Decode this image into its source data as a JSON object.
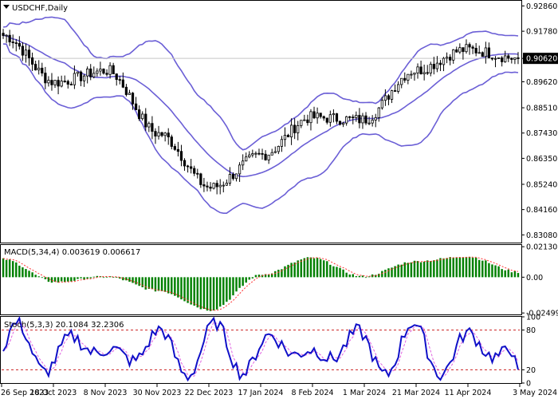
{
  "chart_data": [
    {
      "type": "candlestick",
      "title": "USDCHF,Daily",
      "symbol": "USDCHF",
      "timeframe": "Daily",
      "ylim": [
        0.8275,
        0.9308
      ],
      "y_ticks": [
        "0.92860",
        "0.91780",
        "0.90620",
        "0.89620",
        "0.88510",
        "0.87430",
        "0.86350",
        "0.85240",
        "0.84160",
        "0.83080"
      ],
      "y_tick_values": [
        0.9286,
        0.9178,
        0.9062,
        0.8962,
        0.8851,
        0.8743,
        0.8635,
        0.8524,
        0.8416,
        0.8308
      ],
      "current_price": 0.9062,
      "current_price_label": "0.90620",
      "bollinger_bands": true,
      "key_closes": [
        {
          "date": "26 Sep 2023",
          "close": 0.916
        },
        {
          "date": "18 Oct 2023",
          "close": 0.896
        },
        {
          "date": "8 Nov 2023",
          "close": 0.901
        },
        {
          "date": "30 Nov 2023",
          "close": 0.874
        },
        {
          "date": "22 Dec 2023",
          "close": 0.851
        },
        {
          "date": "17 Jan 2024",
          "close": 0.865
        },
        {
          "date": "8 Feb 2024",
          "close": 0.881
        },
        {
          "date": "1 Mar 2024",
          "close": 0.88
        },
        {
          "date": "21 Mar 2024",
          "close": 0.901
        },
        {
          "date": "11 Apr 2024",
          "close": 0.91
        },
        {
          "date": "3 May 2024",
          "close": 0.9062
        }
      ],
      "x_labels": [
        "26 Sep 2023",
        "18 Oct 2023",
        "8 Nov 2023",
        "30 Nov 2023",
        "22 Dec 2023",
        "17 Jan 2024",
        "8 Feb 2024",
        "1 Mar 2024",
        "21 Mar 2024",
        "11 Apr 2024",
        "3 May 2024"
      ],
      "colors": {
        "band": "#6b5fd6",
        "candle": "#000000",
        "price_tag": "#000000",
        "price_line": "#c8c8c8"
      }
    },
    {
      "type": "bar",
      "title": "MACD(5,34,4) 0.003619 0.006617",
      "name": "MACD",
      "params": "5,34,4",
      "value_main": "0.003619",
      "value_signal": "0.006617",
      "ylim": [
        -0.026,
        0.0225
      ],
      "y_ticks": [
        "0.021303",
        "0.00",
        "-0.024996"
      ],
      "y_tick_values": [
        0.021303,
        0.0,
        -0.024996
      ],
      "histogram_key_values": [
        {
          "date": "26 Sep 2023",
          "value": 0.0125
        },
        {
          "date": "18 Oct 2023",
          "value": -0.0035
        },
        {
          "date": "8 Nov 2023",
          "value": 0.0005
        },
        {
          "date": "30 Nov 2023",
          "value": -0.0095
        },
        {
          "date": "22 Dec 2023",
          "value": -0.023
        },
        {
          "date": "17 Jan 2024",
          "value": 0.002
        },
        {
          "date": "8 Feb 2024",
          "value": 0.0135
        },
        {
          "date": "1 Mar 2024",
          "value": 0.0005
        },
        {
          "date": "21 Mar 2024",
          "value": 0.011
        },
        {
          "date": "11 Apr 2024",
          "value": 0.0145
        },
        {
          "date": "3 May 2024",
          "value": 0.0036
        }
      ],
      "colors": {
        "histogram": "#008000",
        "signal": "#ff3030"
      }
    },
    {
      "type": "line",
      "title": "Stoch(5,3,3) 20.1084 32.2306",
      "name": "Stoch",
      "params": "5,3,3",
      "value_main": "20.1084",
      "value_signal": "32.2306",
      "ylim": [
        0,
        100
      ],
      "y_ticks": [
        "100",
        "80",
        "20",
        "0"
      ],
      "y_tick_values": [
        100,
        80,
        20,
        0
      ],
      "levels": [
        80,
        20
      ],
      "k_key_values": [
        {
          "date": "26 Sep 2023",
          "value": 60
        },
        {
          "date": "18 Oct 2023",
          "value": 15
        },
        {
          "date": "8 Nov 2023",
          "value": 70
        },
        {
          "date": "30 Nov 2023",
          "value": 60
        },
        {
          "date": "22 Dec 2023",
          "value": 20
        },
        {
          "date": "17 Jan 2024",
          "value": 80
        },
        {
          "date": "8 Feb 2024",
          "value": 80
        },
        {
          "date": "1 Mar 2024",
          "value": 20
        },
        {
          "date": "21 Mar 2024",
          "value": 78
        },
        {
          "date": "11 Apr 2024",
          "value": 60
        },
        {
          "date": "3 May 2024",
          "value": 20
        }
      ],
      "colors": {
        "k_line": "#1010c8",
        "d_line": "#e060e0",
        "level_line": "#cc2020"
      }
    }
  ]
}
